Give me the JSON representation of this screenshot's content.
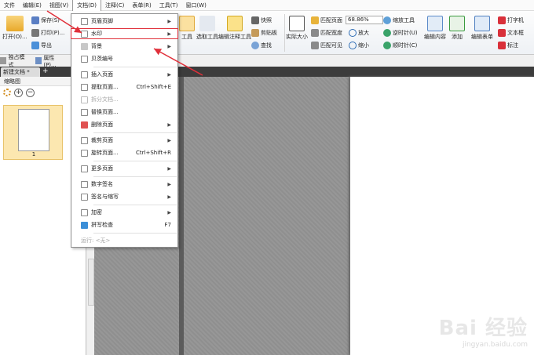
{
  "menubar": [
    "文件",
    "编辑(E)",
    "视图(V)",
    "文档(D)",
    "注释(C)",
    "表单(R)",
    "工具(T)",
    "窗口(W)"
  ],
  "ribbon": {
    "open": "打开(O)...",
    "save": "保存(S)",
    "print": "打印(P)...",
    "export": "导出",
    "snapshot_tool": "工具",
    "select_tool": "选取工具",
    "edit_annot": "编辑注释工具",
    "snapshot": "快照",
    "clipboard": "剪贴板",
    "search": "查找",
    "actual_size": "实际大小",
    "fit_page": "匹配页面",
    "fit_width": "匹配宽度",
    "fit_visible": "匹配可见",
    "zoom_value": "68.86%",
    "zoom_tool": "缩放工具",
    "zoom_in": "放大",
    "zoom_out": "缩小",
    "rotate_ccw": "逆时针(U)",
    "rotate_cw": "顺时针(C)",
    "edit_content": "编辑内容",
    "add": "添加",
    "edit_form": "编辑表单",
    "typewriter": "打字机",
    "textbox": "文本框",
    "callout": "标注"
  },
  "subbar": {
    "single": "独占模式",
    "props": "属性(P)..."
  },
  "tab": {
    "label": "新建文档 *",
    "add": "+"
  },
  "leftpanel": {
    "title": "缩略图",
    "page_number": "1"
  },
  "menu": {
    "header_footer": "页眉页脚",
    "watermark": "水印",
    "background": "背景",
    "bates": "贝茨编号",
    "insert_page": "插入页面",
    "extract_page": "提取页面...",
    "extract_shortcut": "Ctrl+Shift+E",
    "split_doc": "拆分文档...",
    "replace_page": "替换页面...",
    "delete_page": "删除页面",
    "crop_page": "裁剪页面",
    "rotate_page": "旋转页面...",
    "rotate_shortcut": "Ctrl+Shift+R",
    "more_pages": "更多页面",
    "digital_sign": "数字签名",
    "sign_initial": "签名与缩写",
    "encrypt": "加密",
    "spellcheck": "拼写检查",
    "spellcheck_shortcut": "F7",
    "run": "运行:",
    "run_value": "<无>"
  },
  "watermark": {
    "logo": "Bai 经验",
    "url": "jingyan.baidu.com"
  },
  "colors": {
    "accent": "#e0303a",
    "highlight": "#fce7b0",
    "tabbar": "#3c3c3c"
  }
}
